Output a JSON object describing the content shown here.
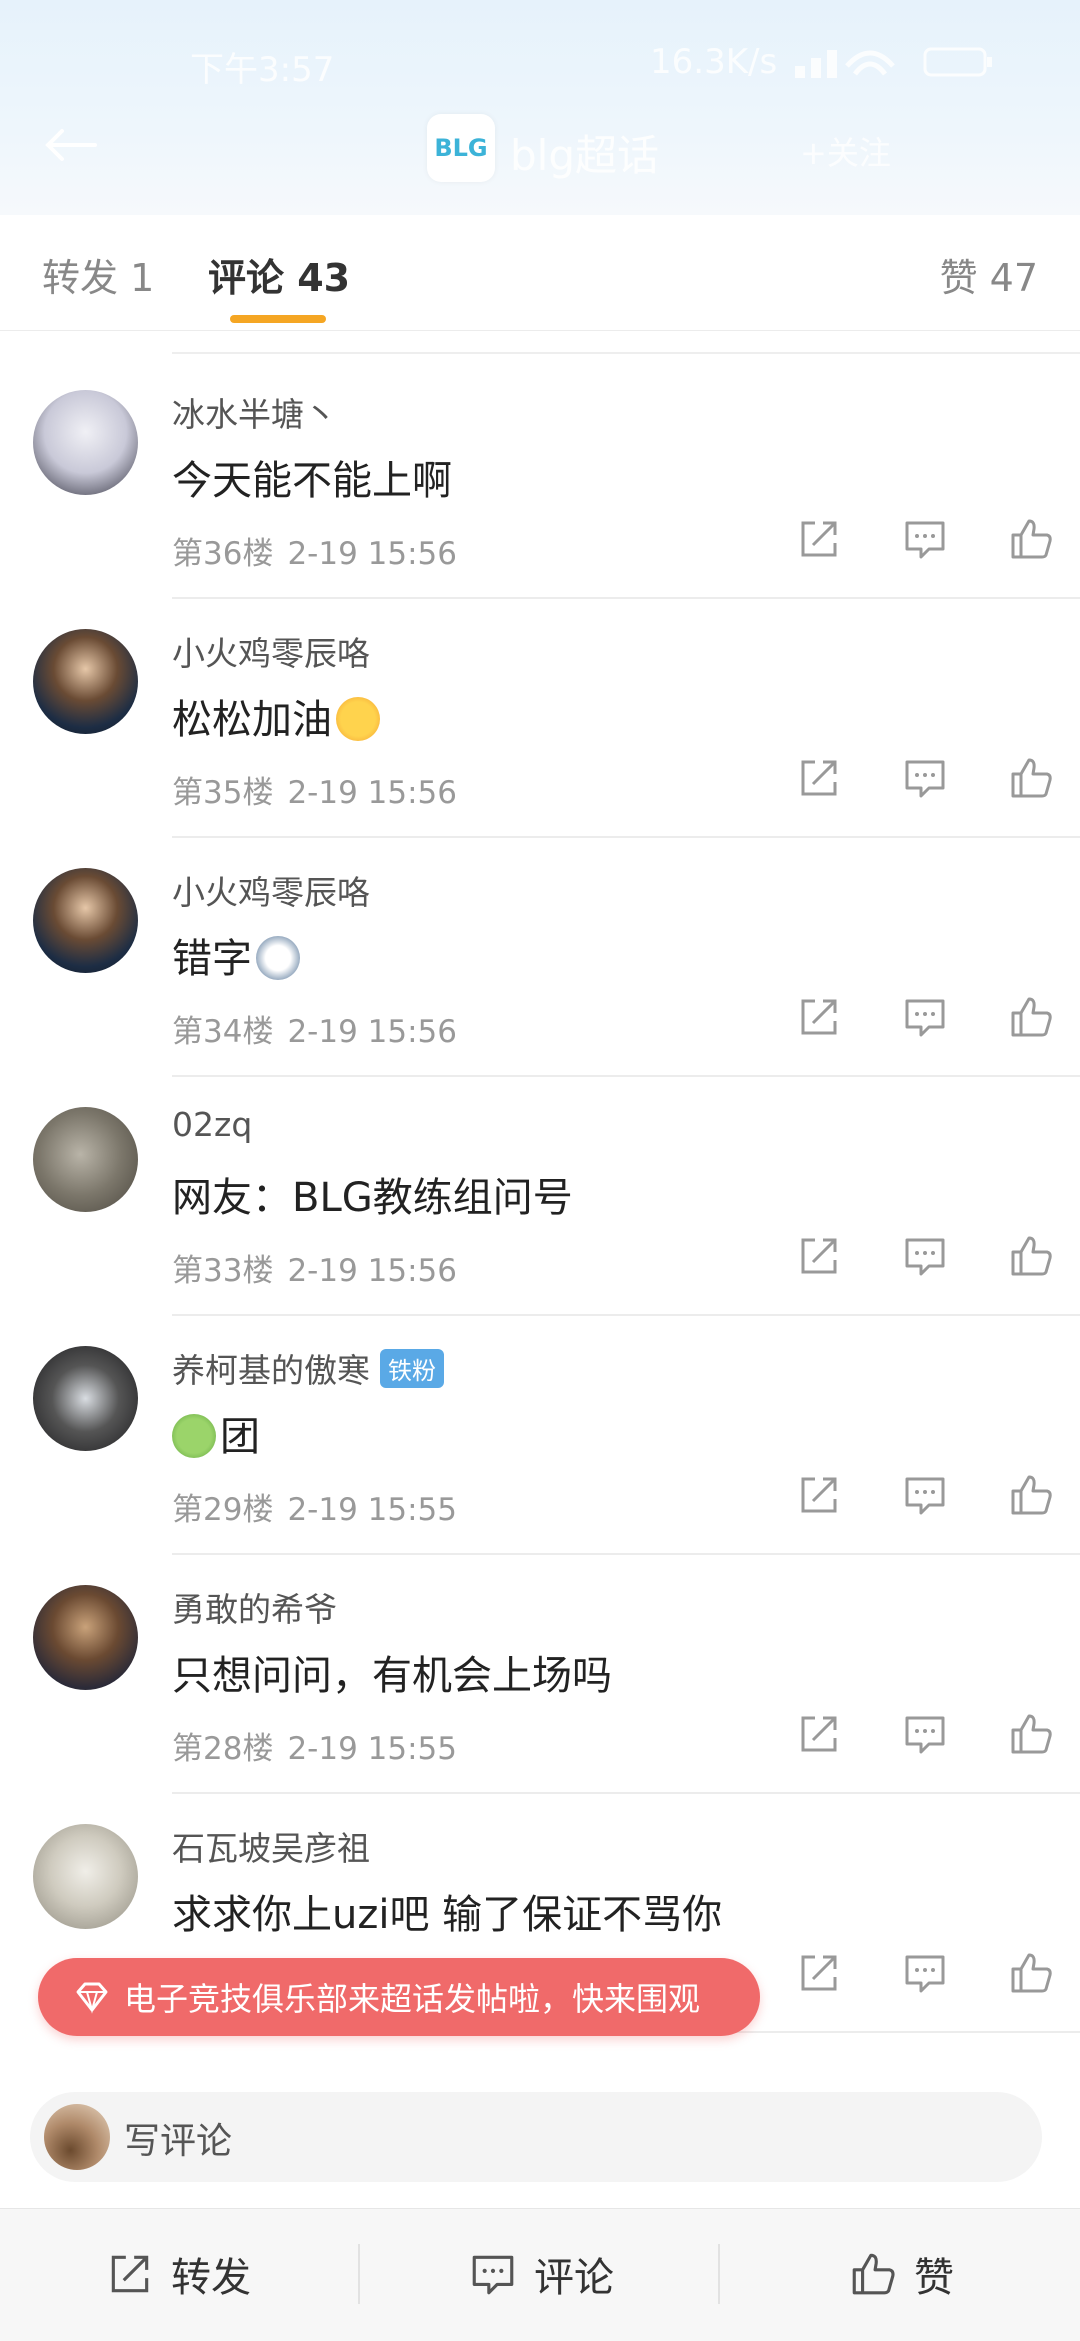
{
  "status_bar": {
    "time": "下午3:57",
    "network_speed": "16.3K/s"
  },
  "nav": {
    "brand_logo_text": "BLG",
    "title": "blg超话",
    "join_label": "+关注"
  },
  "tabs": {
    "repost": "转发 1",
    "comment": "评论 43",
    "like": "赞 47"
  },
  "comments": [
    {
      "username": "冰水半塘丶",
      "text": "今天能不能上啊",
      "floor": "第36楼",
      "time": "2-19 15:56"
    },
    {
      "username": "小火鸡零辰咯",
      "text": "松松加油",
      "floor": "第35楼",
      "time": "2-19 15:56",
      "emoji": "cheer-emoji"
    },
    {
      "username": "小火鸡零辰咯",
      "text": "错字",
      "floor": "第34楼",
      "time": "2-19 15:56",
      "emoji": "husky-emoji"
    },
    {
      "username": "02zq",
      "text": "网友：BLG教练组问号",
      "floor": "第33楼",
      "time": "2-19 15:56"
    },
    {
      "username": "养柯基的傲寒",
      "badge": "铁粉",
      "text": "团",
      "floor": "第29楼",
      "time": "2-19 15:55",
      "emoji": "frog-emoji"
    },
    {
      "username": "勇敢的希爷",
      "text": "只想问问，有机会上场吗",
      "floor": "第28楼",
      "time": "2-19 15:55"
    },
    {
      "username": "石瓦坡吴彦祖",
      "text": "求求你上uzi吧 输了保证不骂你",
      "floor": "",
      "time": ""
    }
  ],
  "banner": {
    "text": "电子竞技俱乐部来超话发帖啦，快来围观"
  },
  "input": {
    "placeholder": "写评论"
  },
  "bottom_bar": {
    "repost": "转发",
    "comment": "评论",
    "like": "赞"
  },
  "colors": {
    "accent": "#f5a623",
    "banner": "#f06a6a",
    "badge": "#5aa9e6"
  }
}
